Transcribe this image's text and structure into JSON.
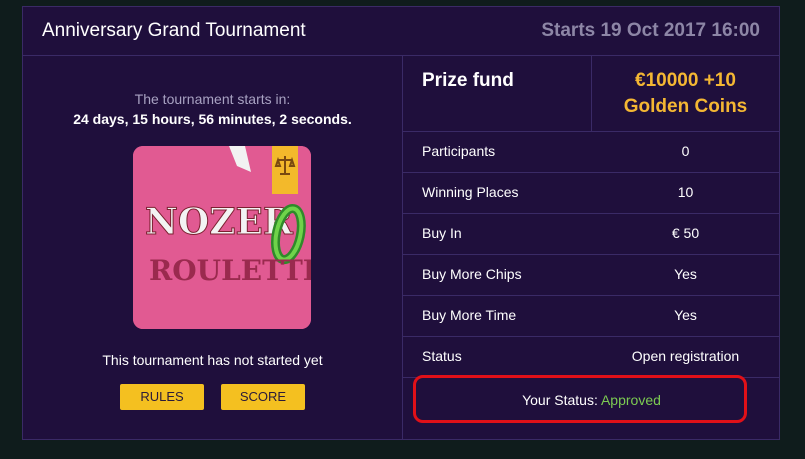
{
  "header": {
    "title": "Anniversary Grand Tournament",
    "starts": "Starts 19 Oct 2017 16:00"
  },
  "countdown": {
    "label": "The tournament starts in:",
    "value": "24 days, 15 hours, 56 minutes, 2 seconds."
  },
  "game": {
    "logo_line1": "NOZER",
    "logo_o": "0",
    "logo_line2": "ROULETTE"
  },
  "status_text": "This tournament has not started yet",
  "buttons": {
    "rules": "RULES",
    "score": "SCORE"
  },
  "prize": {
    "label": "Prize fund",
    "value_line1": "€10000 +10",
    "value_line2": "Golden Coins"
  },
  "details": [
    {
      "label": "Participants",
      "value": "0"
    },
    {
      "label": "Winning Places",
      "value": "10"
    },
    {
      "label": "Buy In",
      "value": "€ 50"
    },
    {
      "label": "Buy More Chips",
      "value": "Yes"
    },
    {
      "label": "Buy More Time",
      "value": "Yes"
    },
    {
      "label": "Status",
      "value": "Open registration"
    }
  ],
  "your_status": {
    "label": "Your Status: ",
    "value": "Approved"
  },
  "colors": {
    "background": "#1f0f3c",
    "accent_gold": "#f4b733",
    "button": "#f4c020",
    "approved": "#7ccb52",
    "highlight": "#e01018"
  },
  "icons": [
    "scales-icon"
  ]
}
